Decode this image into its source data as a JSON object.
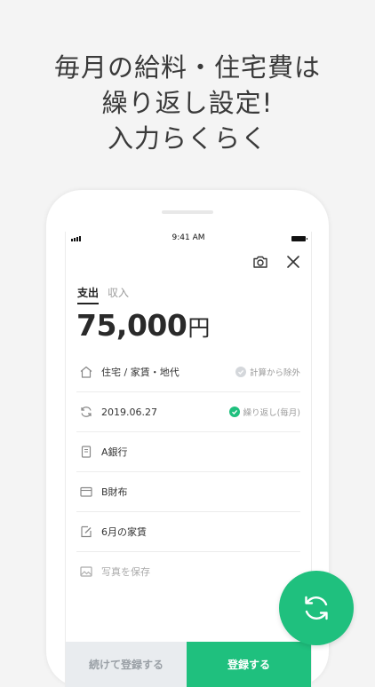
{
  "headline": {
    "line1": "毎月の給料・住宅費は",
    "line2": "繰り返し設定!",
    "line3": "入力らくらく"
  },
  "statusbar": {
    "time": "9:41 AM"
  },
  "tabs": [
    {
      "label": "支出",
      "active": true
    },
    {
      "label": "収入",
      "active": false
    }
  ],
  "amount": {
    "value": "75,000",
    "unit": "円"
  },
  "rows": {
    "category": {
      "text": "住宅 / 家賃・地代",
      "side": "計算から除外",
      "checked": false
    },
    "date": {
      "text": "2019.06.27",
      "side": "繰り返し(毎月)",
      "checked": true
    },
    "account": {
      "text": "A銀行"
    },
    "wallet": {
      "text": "B財布"
    },
    "memo": {
      "text": "6月の家賃"
    },
    "photo": {
      "placeholder": "写真を保存"
    }
  },
  "buttons": {
    "continue_label": "続けて登録する",
    "register_label": "登録する"
  },
  "colors": {
    "accent": "#1fc07e",
    "background": "#f4f4f4"
  }
}
